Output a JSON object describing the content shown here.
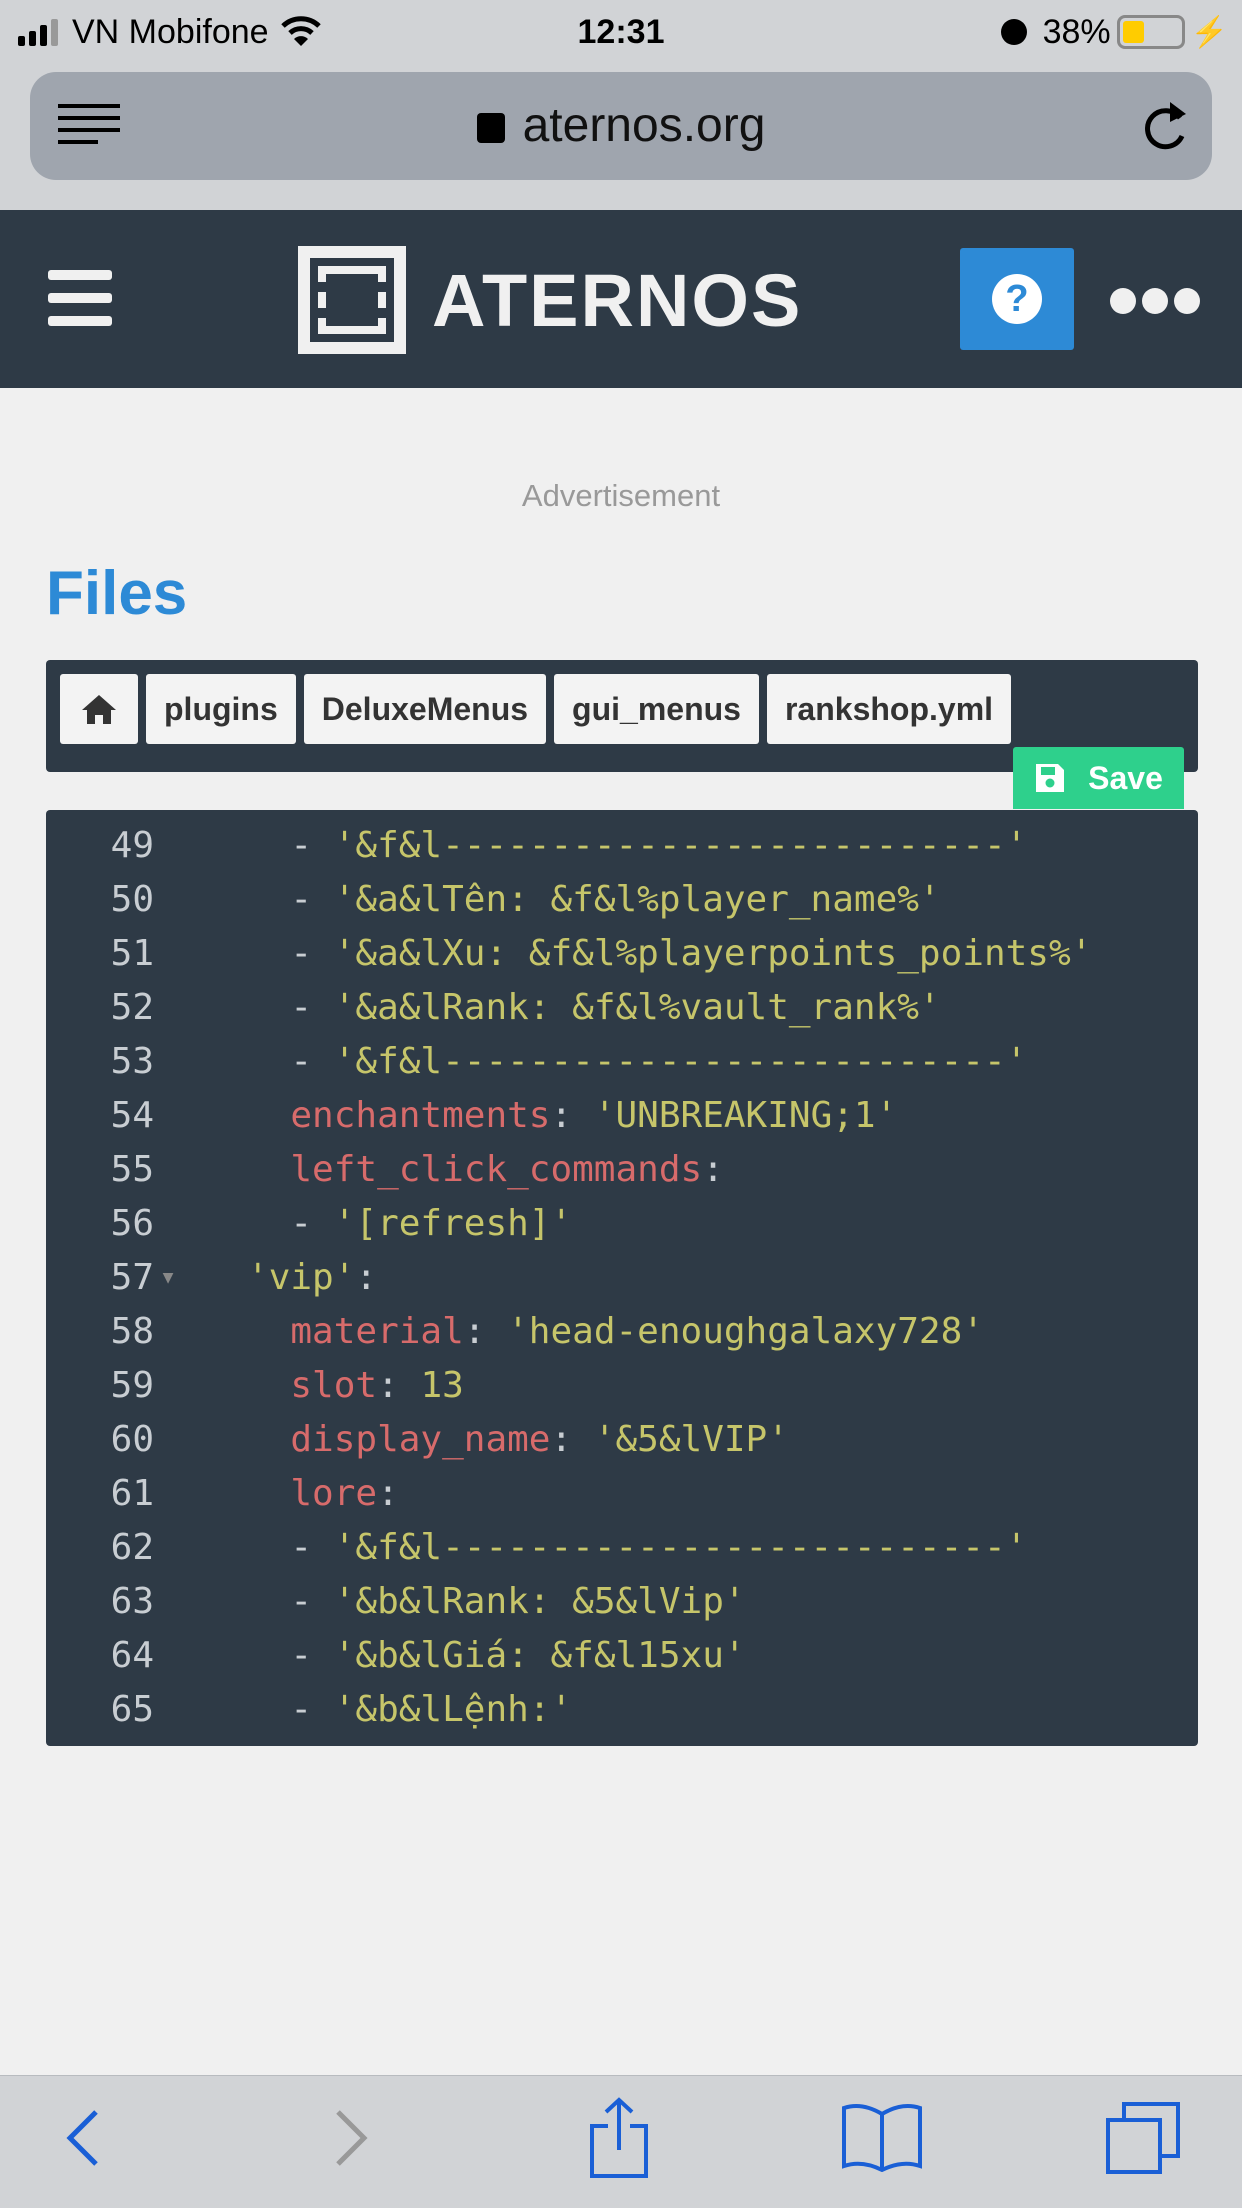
{
  "status_bar": {
    "carrier": "VN Mobifone",
    "time": "12:31",
    "battery": "38%",
    "battery_level": 0.38
  },
  "browser": {
    "url": "aternos.org"
  },
  "site": {
    "brand": "ATERNOS",
    "help_icon": "question-circle-icon",
    "more_icon": "ellipsis-icon"
  },
  "page": {
    "advertisement": "Advertisement",
    "title": "Files"
  },
  "breadcrumbs": [
    "plugins",
    "DeluxeMenus",
    "gui_menus",
    "rankshop.yml"
  ],
  "save_label": "Save",
  "colors": {
    "accent": "#2d8ad6",
    "save": "#2ed08c",
    "dark": "#2e3a46"
  },
  "code": [
    {
      "n": "49",
      "indent": "  ",
      "parts": [
        {
          "t": "- ",
          "c": "p"
        },
        {
          "t": "'&f&l--------------------------'",
          "c": "s"
        }
      ]
    },
    {
      "n": "50",
      "indent": "  ",
      "parts": [
        {
          "t": "- ",
          "c": "p"
        },
        {
          "t": "'&a&lTên: &f&l%player_name%'",
          "c": "s"
        }
      ]
    },
    {
      "n": "51",
      "indent": "  ",
      "parts": [
        {
          "t": "- ",
          "c": "p"
        },
        {
          "t": "'&a&lXu: &f&l%playerpoints_points%'",
          "c": "s"
        }
      ]
    },
    {
      "n": "52",
      "indent": "  ",
      "parts": [
        {
          "t": "- ",
          "c": "p"
        },
        {
          "t": "'&a&lRank: &f&l%vault_rank%'",
          "c": "s"
        }
      ]
    },
    {
      "n": "53",
      "indent": "  ",
      "parts": [
        {
          "t": "- ",
          "c": "p"
        },
        {
          "t": "'&f&l--------------------------'",
          "c": "s"
        }
      ]
    },
    {
      "n": "54",
      "indent": "  ",
      "parts": [
        {
          "t": "enchantments",
          "c": "k"
        },
        {
          "t": ": ",
          "c": "p"
        },
        {
          "t": "'UNBREAKING;1'",
          "c": "s"
        }
      ]
    },
    {
      "n": "55",
      "indent": "  ",
      "parts": [
        {
          "t": "left_click_commands",
          "c": "k"
        },
        {
          "t": ":",
          "c": "p"
        }
      ]
    },
    {
      "n": "56",
      "indent": "  ",
      "parts": [
        {
          "t": "- ",
          "c": "p"
        },
        {
          "t": "'[refresh]'",
          "c": "s"
        }
      ]
    },
    {
      "n": "57",
      "indent": "",
      "fold": true,
      "parts": [
        {
          "t": "'vip'",
          "c": "s"
        },
        {
          "t": ":",
          "c": "p"
        }
      ]
    },
    {
      "n": "58",
      "indent": "  ",
      "parts": [
        {
          "t": "material",
          "c": "k"
        },
        {
          "t": ": ",
          "c": "p"
        },
        {
          "t": "'head-enoughgalaxy728'",
          "c": "s"
        }
      ]
    },
    {
      "n": "59",
      "indent": "  ",
      "parts": [
        {
          "t": "slot",
          "c": "k"
        },
        {
          "t": ": ",
          "c": "p"
        },
        {
          "t": "13",
          "c": "s"
        }
      ]
    },
    {
      "n": "60",
      "indent": "  ",
      "parts": [
        {
          "t": "display_name",
          "c": "k"
        },
        {
          "t": ": ",
          "c": "p"
        },
        {
          "t": "'&5&lVIP'",
          "c": "s"
        }
      ]
    },
    {
      "n": "61",
      "indent": "  ",
      "parts": [
        {
          "t": "lore",
          "c": "k"
        },
        {
          "t": ":",
          "c": "p"
        }
      ]
    },
    {
      "n": "62",
      "indent": "  ",
      "parts": [
        {
          "t": "- ",
          "c": "p"
        },
        {
          "t": "'&f&l--------------------------'",
          "c": "s"
        }
      ]
    },
    {
      "n": "63",
      "indent": "  ",
      "parts": [
        {
          "t": "- ",
          "c": "p"
        },
        {
          "t": "'&b&lRank: &5&lVip'",
          "c": "s"
        }
      ]
    },
    {
      "n": "64",
      "indent": "  ",
      "parts": [
        {
          "t": "- ",
          "c": "p"
        },
        {
          "t": "'&b&lGiá: &f&l15xu'",
          "c": "s"
        }
      ]
    },
    {
      "n": "65",
      "indent": "  ",
      "parts": [
        {
          "t": "- ",
          "c": "p"
        },
        {
          "t": "'&b&lLệnh:'",
          "c": "s"
        }
      ]
    }
  ]
}
